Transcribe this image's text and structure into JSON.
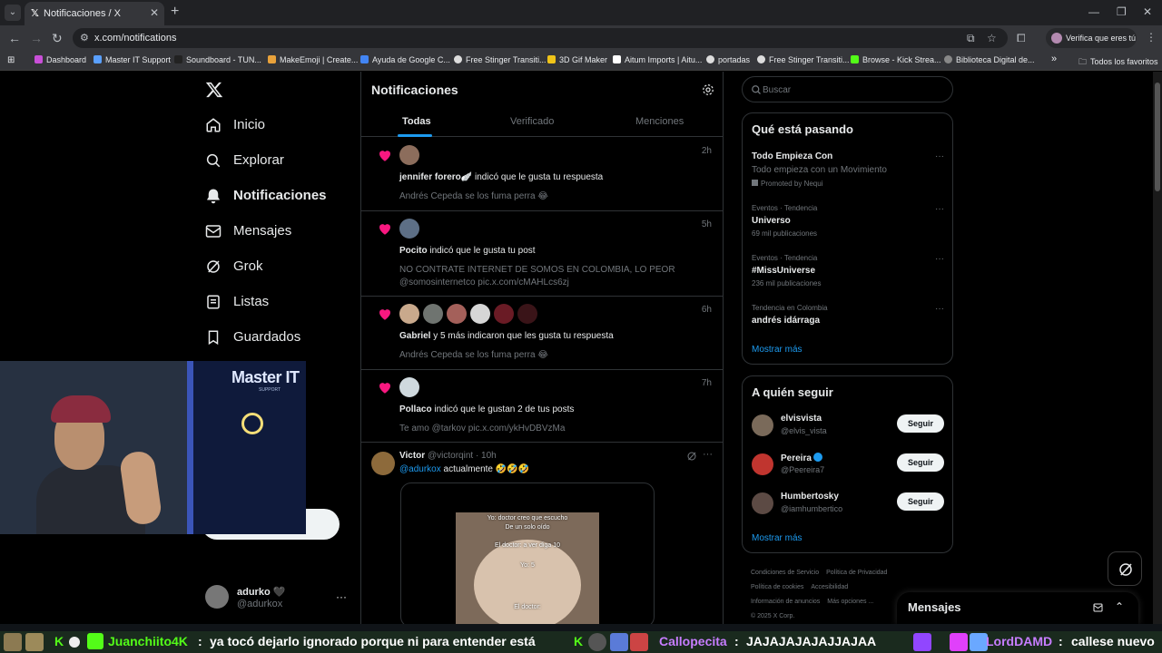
{
  "browser": {
    "tab_title": "Notificaciones / X",
    "url": "x.com/notifications",
    "profile_label": "Verifica que eres tú",
    "bookmarks": [
      "Dashboard",
      "Master IT Support",
      "Soundboard - TUN...",
      "MakeEmoji | Create...",
      "Ayuda de Google C...",
      "Free Stinger Transiti...",
      "3D Gif Maker",
      "Aitum Imports | Aitu...",
      "portadas",
      "Free Stinger Transiti...",
      "Browse - Kick Strea...",
      "Biblioteca Digital de..."
    ],
    "bookmarks_overflow": "»",
    "all_bookmarks": "Todos los favoritos"
  },
  "nav": {
    "items": [
      "Inicio",
      "Explorar",
      "Notificaciones",
      "Mensajes",
      "Grok",
      "Listas",
      "Guardados"
    ],
    "active": "Notificaciones",
    "account_name": "adurko 🖤",
    "account_handle": "@adurkox"
  },
  "webcam": {
    "logo": "Master IT",
    "logo_sub": "SUPPORT"
  },
  "notifications": {
    "title": "Notificaciones",
    "tabs": [
      "Todas",
      "Verificado",
      "Menciones"
    ],
    "items": [
      {
        "actor": "jennifer forero🪽",
        "action": " indicó que le gusta tu respuesta",
        "preview": "Andrés Cepeda se los fuma perra 😂",
        "time": "2h"
      },
      {
        "actor": "Pocito",
        "action": " indicó que le gusta tu post",
        "preview": "NO CONTRATE INTERNET DE SOMOS EN COLOMBIA, LO PEOR",
        "preview2": "@somosinternetco pic.x.com/cMAHLcs6zj",
        "time": "5h"
      },
      {
        "actor": "Gabriel",
        "action": " y 5 más indicaron que les gusta tu respuesta",
        "preview": "Andrés Cepeda se los fuma perra 😂",
        "time": "6h"
      },
      {
        "actor": "Pollaco",
        "action": " indicó que le gustan 2 de tus posts",
        "preview": "Te amo @tarkov pic.x.com/ykHvDBVzMa",
        "time": "7h"
      }
    ],
    "tweet": {
      "name": "Victor",
      "handle": "@victorqint · 10h",
      "mention": "@adurkox",
      "text": " actualmente 🤣🤣🤣",
      "meme_lines": [
        "Yo: doctor creo que escucho",
        "De un solo oído",
        "El doctor: a ver diga 10",
        "Yo: 5",
        "El doctor:"
      ]
    }
  },
  "sidebar": {
    "search_placeholder": "Buscar",
    "trends_title": "Qué está pasando",
    "trends": [
      {
        "context": "",
        "name": "Todo Empieza Con",
        "meta": "Todo empieza con un Movimiento",
        "promo": "Promoted by Nequi"
      },
      {
        "context": "Eventos · Tendencia",
        "name": "Universo",
        "meta": "69 mil publicaciones"
      },
      {
        "context": "Eventos · Tendencia",
        "name": "#MissUniverse",
        "meta": "236 mil publicaciones"
      },
      {
        "context": "Tendencia en Colombia",
        "name": "andrés idárraga",
        "meta": ""
      }
    ],
    "show_more": "Mostrar más",
    "follow_title": "A quién seguir",
    "follow": [
      {
        "name": "elvisvista",
        "handle": "@elvis_vista",
        "verified": false
      },
      {
        "name": "Pereira",
        "handle": "@Peereira7",
        "verified": true
      },
      {
        "name": "Humbertosky",
        "handle": "@iamhumbertico",
        "verified": false
      }
    ],
    "follow_label": "Seguir",
    "footer": [
      "Condiciones de Servicio",
      "Política de Privacidad",
      "Política de cookies",
      "Accesibilidad",
      "Información de anuncios",
      "Más opciones ...",
      "© 2025 X Corp."
    ],
    "messages": "Mensajes"
  },
  "chat": {
    "user1": "Juanchiito4K",
    "msg1": "ya tocó dejarlo ignorado porque ni para entender está",
    "user2": "Callopecita",
    "msg2": "JAJAJAJAJAJJAJAA",
    "user3": "LordDAMD",
    "msg3": "callese nuevo"
  },
  "colors": {
    "accent": "#1d9bf0",
    "like": "#f91880",
    "chat_green": "#53fc18",
    "chat_purple": "#c77dff"
  }
}
